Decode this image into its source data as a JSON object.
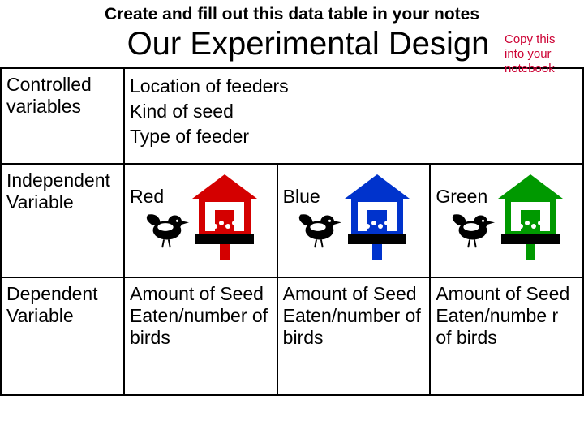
{
  "heading": "Create and fill out this data table in your notes",
  "title": "Our Experimental Design",
  "annotation": "Copy this into your notebook",
  "rows": {
    "controlled": {
      "label": "Controlled variables",
      "lines": [
        "Location of feeders",
        "Kind of seed",
        "Type of feeder"
      ]
    },
    "independent": {
      "label": "Independent Variable",
      "colors": [
        {
          "name": "Red",
          "hex": "#d40000"
        },
        {
          "name": "Blue",
          "hex": "#0033cc"
        },
        {
          "name": "Green",
          "hex": "#009900"
        }
      ]
    },
    "dependent": {
      "label": "Dependent Variable",
      "values": [
        "Amount of Seed Eaten/number of birds",
        "Amount of Seed Eaten/number of birds",
        "Amount of Seed Eaten/numbe r of birds"
      ]
    }
  }
}
